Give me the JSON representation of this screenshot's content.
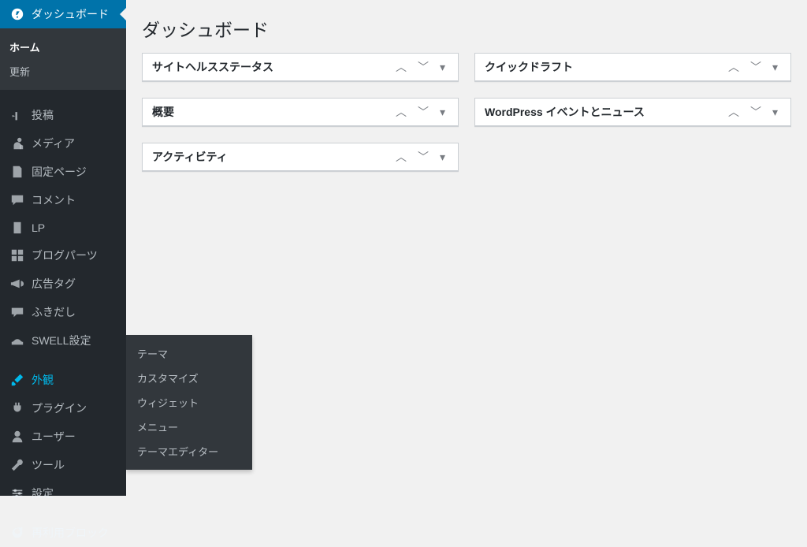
{
  "sidebar": {
    "dashboard": {
      "label": "ダッシュボード"
    },
    "sub": {
      "home": "ホーム",
      "updates": "更新"
    },
    "items": [
      {
        "label": "投稿"
      },
      {
        "label": "メディア"
      },
      {
        "label": "固定ページ"
      },
      {
        "label": "コメント"
      },
      {
        "label": "LP"
      },
      {
        "label": "ブログパーツ"
      },
      {
        "label": "広告タグ"
      },
      {
        "label": "ふきだし"
      },
      {
        "label": "SWELL設定"
      },
      {
        "label": "外観"
      },
      {
        "label": "プラグイン"
      },
      {
        "label": "ユーザー"
      },
      {
        "label": "ツール"
      },
      {
        "label": "設定"
      },
      {
        "label": "再利用ブロック"
      }
    ]
  },
  "submenu": {
    "themes": "テーマ",
    "customize": "カスタマイズ",
    "widgets": "ウィジェット",
    "menus": "メニュー",
    "editor": "テーマエディター"
  },
  "main": {
    "title": "ダッシュボード",
    "boxes": {
      "site_health": "サイトヘルスステータス",
      "quick_draft": "クイックドラフト",
      "at_a_glance": "概要",
      "events_news": "WordPress イベントとニュース",
      "activity": "アクティビティ"
    }
  },
  "icons": {
    "up": "⌃",
    "down": "⌄",
    "menu": "▾"
  }
}
